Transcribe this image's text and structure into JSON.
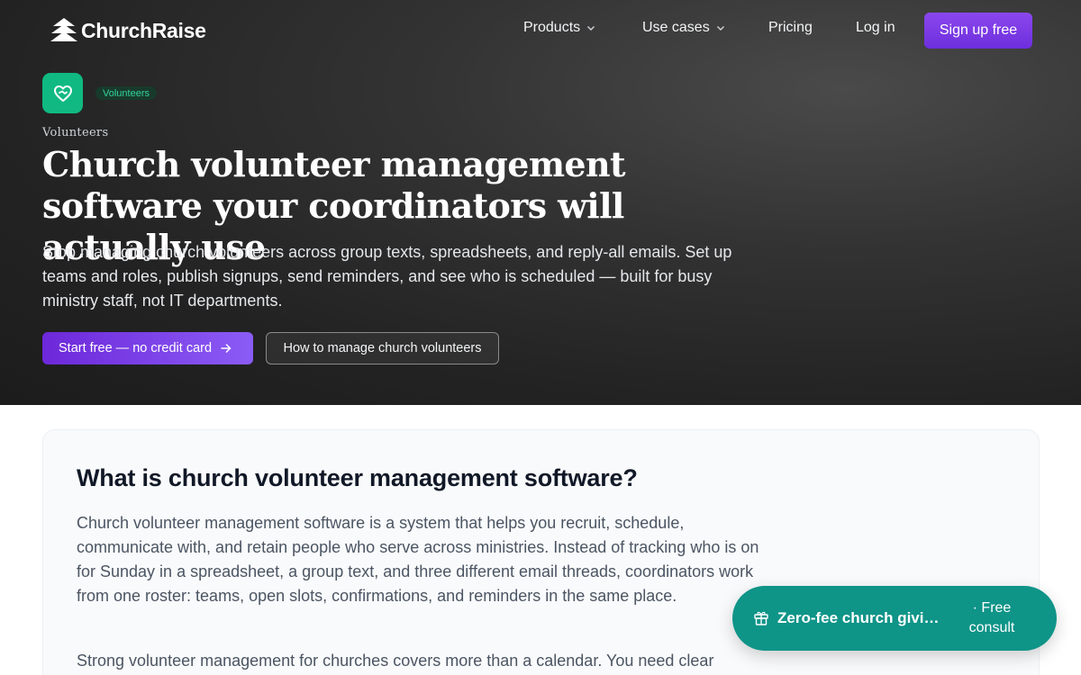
{
  "brand": {
    "name": "ChurchRaise"
  },
  "nav": {
    "products": "Products",
    "use_cases": "Use cases",
    "pricing": "Pricing",
    "login": "Log in",
    "signup": "Sign up free"
  },
  "hero": {
    "pill": "Volunteers",
    "eyebrow": "Volunteers",
    "headline": "Church volunteer management software your coordinators will actually use",
    "subtext": "Stop managing church volunteers across group texts, spreadsheets, and reply-all emails. Set up teams and roles, publish signups, send reminders, and see who is scheduled — built for busy ministry staff, not IT departments.",
    "cta_primary": "Start free — no credit card",
    "cta_secondary": "How to manage church volunteers"
  },
  "section": {
    "title": "What is church volunteer management software?",
    "p1": "Church volunteer management software is a system that helps you recruit, schedule, communicate with, and retain people who serve across ministries. Instead of tracking who is on for Sunday in a spreadsheet, a group text, and three different email threads, coordinators work from one roster: teams, open slots, confirmations, and reminders in the same place.",
    "p2": "Strong volunteer management for churches covers more than a calendar. You need clear"
  },
  "promo": {
    "main": "Zero-fee church giving",
    "side": "· Free consult"
  },
  "colors": {
    "accent": "#7c3aed",
    "brand_green": "#10b981",
    "promo_teal": "#0f9488"
  },
  "icons": [
    "logo-church-icon",
    "chevron-down-icon",
    "heart-hands-icon",
    "arrow-right-icon",
    "gift-icon"
  ]
}
